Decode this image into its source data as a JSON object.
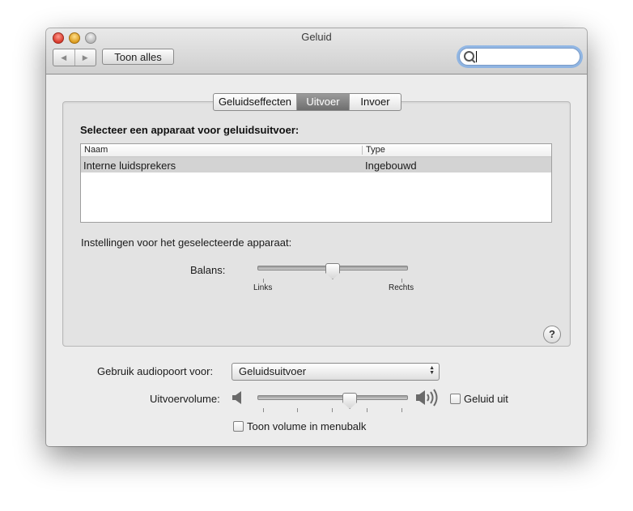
{
  "window": {
    "title": "Geluid"
  },
  "toolbar": {
    "back_icon": "◀",
    "forward_icon": "▶",
    "show_all_label": "Toon alles",
    "search_value": "",
    "search_placeholder": ""
  },
  "tabs": [
    {
      "label": "Geluidseffecten",
      "active": false
    },
    {
      "label": "Uitvoer",
      "active": true
    },
    {
      "label": "Invoer",
      "active": false
    }
  ],
  "output": {
    "heading": "Selecteer een apparaat voor geluidsuitvoer:",
    "columns": [
      "Naam",
      "Type"
    ],
    "rows": [
      {
        "name": "Interne luidsprekers",
        "type": "Ingebouwd",
        "selected": true
      }
    ],
    "settings_label": "Instellingen voor het geselecteerde apparaat:",
    "balance_label": "Balans:",
    "balance_left_label": "Links",
    "balance_right_label": "Rechts",
    "balance_value": 0.5
  },
  "help_label": "?",
  "bottom": {
    "port_label": "Gebruik audiopoort voor:",
    "port_value": "Geluidsuitvoer",
    "volume_label": "Uitvoervolume:",
    "volume_value": 0.62,
    "mute_label": "Geluid uit",
    "mute_checked": false,
    "menubar_label": "Toon volume in menubalk",
    "menubar_checked": false
  }
}
